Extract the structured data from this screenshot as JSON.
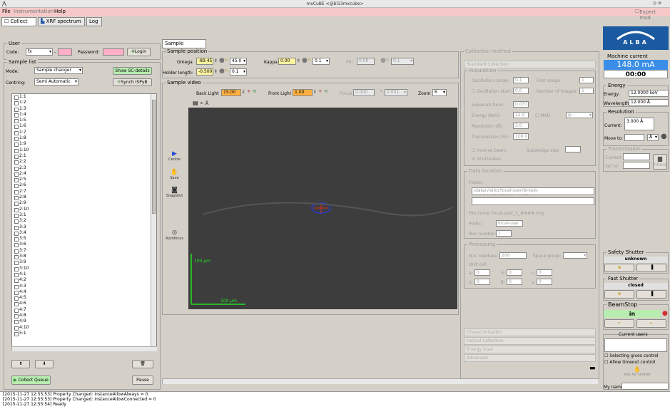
{
  "window": {
    "title": "mxCuBE <@bl13mxcube>"
  },
  "menu": {
    "file": "File",
    "instrumentation": "Instrumentation",
    "help": "Help",
    "expert_mode": "Expert mod"
  },
  "tabs": {
    "collect": "Collect",
    "xrf": "XRF spectrum",
    "log": "Log"
  },
  "user": {
    "title": "User",
    "code_label": "Code:",
    "code_value": "fx",
    "password_label": "Password:",
    "login": "Login"
  },
  "sample_list": {
    "title": "Sample list",
    "mode_label": "Mode:",
    "mode_value": "Sample changer",
    "show_sc": "Show SC-details",
    "centring_label": "Centring:",
    "centring_value": "Semi Automatic",
    "synch": "Synch ISPyB",
    "items": [
      "1:1",
      "1:2",
      "1:3",
      "1:4",
      "1:5",
      "1:6",
      "1:7",
      "1:8",
      "1:9",
      "1:10",
      "2:1",
      "2:2",
      "2:3",
      "2:4",
      "2:5",
      "2:6",
      "2:7",
      "2:8",
      "2:9",
      "2:10",
      "3:1",
      "3:2",
      "3:3",
      "3:4",
      "3:5",
      "3:6",
      "3:7",
      "3:8",
      "3:9",
      "3:10",
      "4:1",
      "4:2",
      "4:3",
      "4:4",
      "4:5",
      "4:6",
      "4:7",
      "4:8",
      "4:9",
      "4:10",
      "5:1"
    ],
    "collect_queue": "Collect Queue",
    "pause": "Pause"
  },
  "centring": {
    "tab": "Sample centring",
    "position_title": "Sample position",
    "omega_label": "Omega",
    "omega_value": "-89.45",
    "omega_step": "45.0",
    "kappa_label": "Kappa",
    "kappa_value": "0.00",
    "kappa_step": "0.1",
    "phi_label": "Phi",
    "phi_value": "0.00",
    "phi_step": "0.1",
    "holder_label": "Holder length:",
    "holder_value": "-0.500",
    "holder_step": "0.1",
    "video_title": "Sample video",
    "back_light_label": "Back Light",
    "back_light_value": "15.00",
    "front_light_label": "Front Light",
    "front_light_value": "1.00",
    "focus_label": "Focus",
    "focus_value": "0.000",
    "focus_step": "0.001",
    "zoom_label": "Zoom",
    "zoom_value": "6",
    "scale_v": "100 µm",
    "scale_h": "100 µm",
    "centre": "Centre",
    "save": "Save",
    "snapshot": "Snapshot",
    "autofocus": "Autofocus"
  },
  "collection": {
    "title": "Collection method",
    "standard": "Standard Collection",
    "acquisition": "Acquisition",
    "osc_range_label": "Oscillation range:",
    "osc_range": "0.1",
    "first_image_label": "First image:",
    "first_image": "1",
    "osc_start_label": "Oscillation start:",
    "osc_start": "0.0",
    "num_images_label": "Number of images:",
    "num_images": "1",
    "exposure_label": "Exposure time:",
    "exposure": "0.037",
    "energy_label": "Energy (KeV):",
    "energy": "12.0",
    "mad_label": "MAD",
    "mad_value": "ip -",
    "resolution_label": "Resolution (Å):",
    "resolution": "3.0",
    "transmission_label": "Transmission (%):",
    "transmission": "100.0",
    "inverse_beam": "Inverse beam",
    "subwedge_label": "Subwedge size:",
    "shutterless": "Shutterless",
    "data_location": "Data location",
    "folder_label": "Folder:",
    "folder": "/data/visitor/local-user/bl-test-eh1/20151127/RAW_DATA",
    "file_name": "File name: local-user_1_####.img",
    "prefix_label": "Prefix:",
    "prefix": "local-user",
    "run_label": "Run number:",
    "run": "1",
    "processing": "Processing",
    "residues_label": "N.o. residues:",
    "residues": "200",
    "space_group_label": "Space group:",
    "unit_cell": "Unit cell:",
    "a": "0",
    "b": "0",
    "c": "0",
    "alpha": "0",
    "beta": "0",
    "gamma": "0",
    "characterisation": "Characterisation",
    "helical": "Helical Collection",
    "energy_scan": "Energy Scan",
    "advanced": "Advanced"
  },
  "beamline": {
    "logo": "ALBA",
    "machine_current_label": "Machine current",
    "machine_current": "148.0 mA",
    "clock": "00:00",
    "energy_title": "Energy",
    "energy_label": "Energy:",
    "energy_value": "12.0000 keV",
    "wavelength_label": "Wavelength:",
    "wavelength_value": "12.000 Å",
    "resolution_title": "Resolution",
    "current_label": "Current:",
    "resolution_current": "3.000 Å",
    "move_to_label": "Move to:",
    "unit": "Å",
    "transmission_title": "Transmission",
    "current2": "Current:",
    "set_to": "Set to:",
    "filters": "Filters",
    "safety_shutter": "Safety Shutter",
    "safety_state": "unknown",
    "fast_shutter": "Fast Shutter",
    "fast_state": "closed",
    "beamstop": "BeamStop",
    "beamstop_state": "in",
    "current_users": "Current users",
    "selecting": "Selecting gives control",
    "allow_timeout": "Allow timeout control",
    "ask_control": "Ask for control",
    "my_name": "My name"
  },
  "log": [
    "[2015-11-27 12:55:53] Property Changed: instanceAllowAlways = 0",
    "[2015-11-27 12:55:53] Property Changed: instanceAllowConnected = 0",
    "[2015-11-27 12:55:54] Ready"
  ],
  "colors": {
    "menubar": "#f6c8c8",
    "machine_current_bg": "#3a8ee8",
    "beamstop_bg": "#b8ecb0",
    "orange": "#ffb040",
    "yellow": "#fff5a0",
    "pink": "#ffb0c8"
  }
}
